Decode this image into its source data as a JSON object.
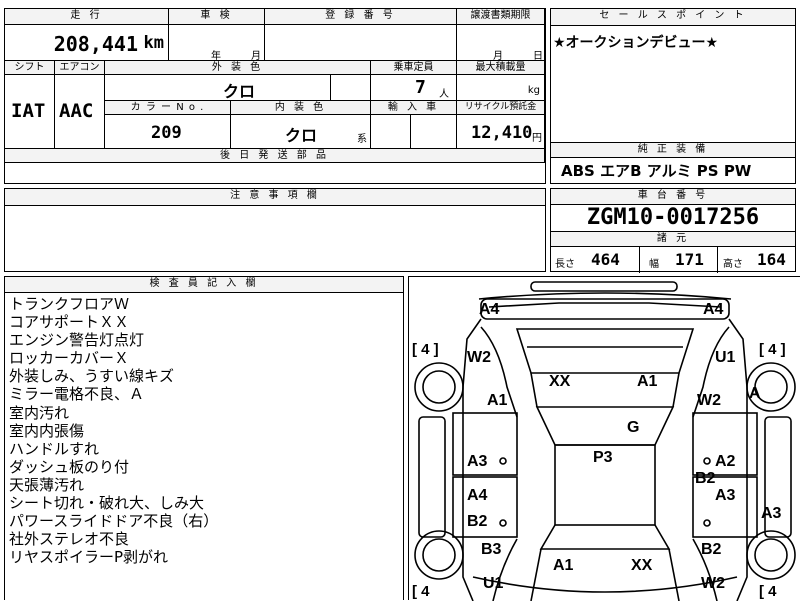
{
  "top": {
    "h_mileage": "走 行",
    "h_inspection": "車 検",
    "h_regno": "登 録 番 号",
    "h_transfer": "譲渡書類期限",
    "mileage_value": "208,441",
    "mileage_unit": "km",
    "insp_year": "年",
    "insp_month": "月",
    "transfer_month": "月",
    "transfer_day": "日",
    "h_shift": "シフト",
    "h_aircon": "エアコン",
    "h_ext_color": "外 装 色",
    "h_capacity": "乗車定員",
    "h_maxload": "最大積載量",
    "shift": "IAT",
    "aircon": "AAC",
    "ext_color": "クロ",
    "capacity": "7",
    "capacity_unit": "人",
    "maxload_unit": "kg",
    "h_color_no": "カ ラ ー N o .",
    "h_int_color": "内 装 色",
    "h_import": "輸 入 車",
    "h_recycle": "リサイクル預託金",
    "color_no": "209",
    "int_color": "クロ",
    "int_color_suffix": "系",
    "recycle": "12,410",
    "recycle_unit": "円",
    "h_later_parts": "後 日 発 送 部 品"
  },
  "sales": {
    "header": "セ ー ル ス ポ イ ン ト",
    "text": "★オークションデビュー★"
  },
  "equipment": {
    "header": "純 正 装 備",
    "items": "ABS エアB アルミ PS PW"
  },
  "caution": {
    "header": "注 意 事 項 欄"
  },
  "chassis": {
    "header": "車 台 番 号",
    "number": "ZGM10-0017256"
  },
  "specs": {
    "header": "諸 元",
    "length_label": "長さ",
    "length": "464",
    "width_label": "幅",
    "width": "171",
    "height_label": "高さ",
    "height": "164"
  },
  "inspector": {
    "header": "検 査 員 記 入 欄",
    "notes": [
      "トランクフロアＷ",
      "コアサポートＸＸ",
      "エンジン警告灯点灯",
      "ロッカーカバーＸ",
      "外装しみ、うすい線キズ",
      "ミラー電格不良、Ａ",
      "室内汚れ",
      "室内内張傷",
      "ハンドルすれ",
      "ダッシュ板のり付",
      "天張薄汚れ",
      "シート切れ・破れ大、しみ大",
      "パワースライドドア不良（右）",
      "社外ステレオ不良",
      "リヤスポイラーP剥がれ"
    ]
  },
  "diagram": {
    "tire_tl": "[ 4 ]",
    "tire_tr": "[ 4 ]",
    "tire_bl": "[ 4",
    "tire_br": "[ 4",
    "marks": {
      "a4_left": "A4",
      "a4_right": "A4",
      "w2_left": "W2",
      "u1_right": "U1",
      "xx_front": "XX",
      "a1_front": "A1",
      "a1_left_fender": "A1",
      "w2_right_fender": "W2",
      "a_right_wheel": "A",
      "g_windshield": "G",
      "p3_roof": "P3",
      "a3_left": "A3",
      "a2_right": "A2",
      "b2_right": "B2",
      "a4_left2": "A4",
      "a3_right": "A3",
      "a3_far_right": "A3",
      "b2_left": "B2",
      "b3_left": "B3",
      "b2_right_rear": "B2",
      "a1_rear": "A1",
      "xx_rear": "XX",
      "u1_left_rear": "U1",
      "w2_right_rear": "W2"
    }
  }
}
